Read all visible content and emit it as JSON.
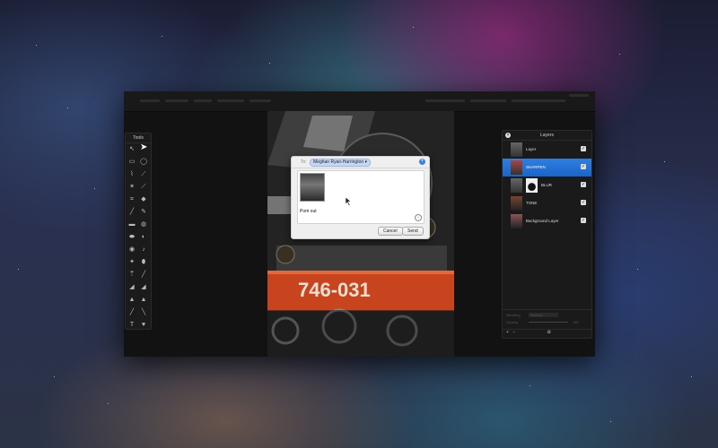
{
  "menubar": {
    "right_label": "Layers"
  },
  "tools": {
    "title": "Tools",
    "items": [
      "arrow-tool",
      "marquee-rect-tool",
      "marquee-ellipse-tool",
      "lasso-tool",
      "poly-lasso-tool",
      "magic-wand-tool",
      "eyedropper-tool",
      "crop-tool",
      "slice-tool",
      "brush-tool",
      "pencil-tool",
      "eraser-tool",
      "fill-tool",
      "blur-tool",
      "sharpen-tool",
      "smudge-tool",
      "dodge-tool",
      "burn-tool",
      "sponge-tool",
      "clone-tool",
      "heal-tool",
      "gradient-tool",
      "shape-tool",
      "line-tool",
      "pen-tool",
      "text-tool",
      "heart-tool",
      "hand-tool",
      "zoom-tool"
    ]
  },
  "layers": {
    "title": "Layers",
    "items": [
      {
        "name": "Layer",
        "selected": false,
        "mask": false
      },
      {
        "name": "SHARPEN",
        "selected": true,
        "mask": false
      },
      {
        "name": "BLUR",
        "selected": false,
        "mask": true
      },
      {
        "name": "TONE",
        "selected": false,
        "mask": false
      },
      {
        "name": "Background Layer",
        "selected": false,
        "mask": false
      }
    ],
    "blending_label": "Blending",
    "blending_value": "Normal",
    "opacity_label": "Opacity",
    "opacity_value": "100"
  },
  "share": {
    "to_label": "To:",
    "recipient": "Meghan Ryan-Harrington ▾",
    "message": "Pom out",
    "cancel_label": "Cancel",
    "send_label": "Send"
  },
  "canvas_text": {
    "plate": "746-031"
  }
}
